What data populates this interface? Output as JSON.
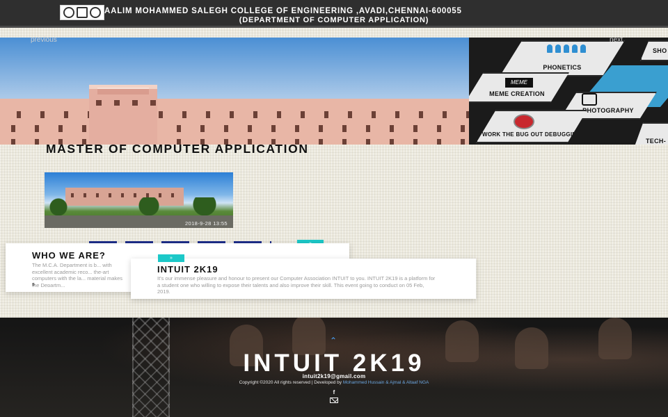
{
  "header": {
    "college": "AALIM MOHAMMED SALEGH COLLEGE OF ENGINEERING ,AVADI,CHENNAI-600055",
    "department": "(DEPARTMENT OF COMPUTER APPLICATION)"
  },
  "slider": {
    "prev_label": "previous",
    "next_label": "next",
    "slide_count": 4,
    "active_slide": 1,
    "events": [
      "PHONETICS",
      "MEME CREATION",
      "PHOTOGRAPHY",
      "WORK THE BUG OUT DEBUGGING",
      "TECH-",
      "SHO"
    ]
  },
  "main": {
    "heading": "MASTER OF COMPUTER APPLICATION",
    "photo_timestamp": "2018-9-28 13:55"
  },
  "cards": {
    "who": {
      "title": "WHO WE ARE?",
      "text": "The M.C.A. Department is b... with excellent academic reco... the-art computers with the la... material makes the Departm...",
      "more": "s"
    },
    "intuit": {
      "title": "INTUIT 2K19",
      "text": "It's our immense pleasure and honour to present our Computer Association INTUIT to you. INTUIT 2K19 is a platform for a student one who willing to expose their talents and also improve their skill. This event going to conduct on 05 Feb, 2019."
    }
  },
  "footer": {
    "title": "INTUIT 2K19",
    "email": "intuit2k19@gmail.com",
    "copyright": "Copyright ©2020 All rights reserved | Developed by ",
    "developer": "Mohammed Hussain & Ajmal & Altaaf NGA"
  },
  "colors": {
    "header_bg": "#2f2f2f",
    "accent_teal": "#1cc8c8",
    "link_blue": "#6aa6e0",
    "page_bg": "#ebe8dc"
  }
}
